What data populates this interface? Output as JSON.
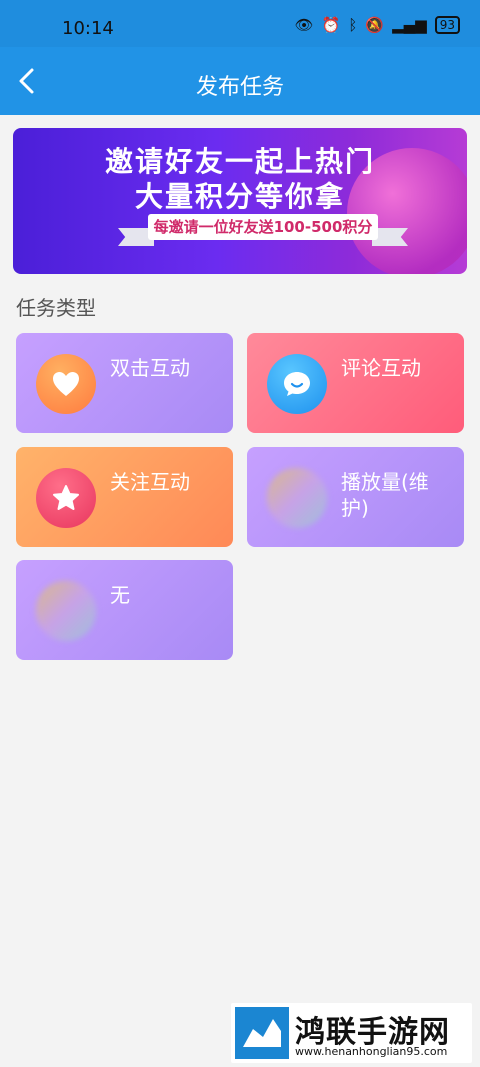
{
  "status": {
    "time": "10:14",
    "battery": "93"
  },
  "appbar": {
    "title": "发布任务"
  },
  "banner": {
    "line1": "邀请好友一起上热门",
    "line2": "大量积分等你拿",
    "ribbon": "每邀请一位好友送100-500积分"
  },
  "section": {
    "title": "任务类型"
  },
  "tasks": [
    {
      "label": "双击互动",
      "icon": "heart-icon"
    },
    {
      "label": "评论互动",
      "icon": "chat-icon"
    },
    {
      "label": "关注互动",
      "icon": "star-icon"
    },
    {
      "label": "播放量(维护)",
      "icon": "blurred-image-icon"
    },
    {
      "label": "无",
      "icon": "blurred-image-icon"
    }
  ],
  "watermark": {
    "name": "鸿联手游网",
    "url": "www.henanhonglian95.com"
  }
}
